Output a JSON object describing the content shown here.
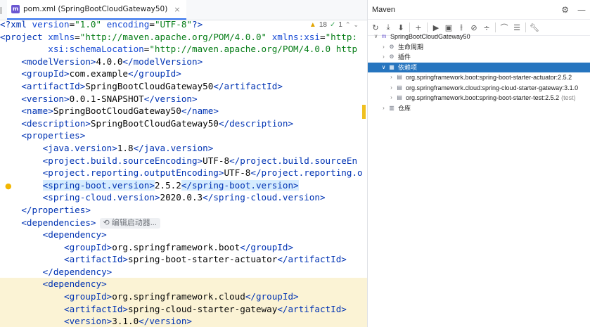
{
  "tab": {
    "label": "pom.xml (SpringBootCloudGateway50)",
    "icon": "maven-file-icon"
  },
  "status": {
    "warnings": "18",
    "checks": "1"
  },
  "code": [
    {
      "parts": [
        [
          "t",
          "<?xml "
        ],
        [
          "a",
          "version"
        ],
        [
          "",
          "="
        ],
        [
          "v",
          "\"1.0\""
        ],
        [
          "a",
          " encoding"
        ],
        [
          "",
          "="
        ],
        [
          "v",
          "\"UTF-8\""
        ],
        [
          "t",
          "?>"
        ]
      ]
    },
    {
      "parts": [
        [
          "t",
          "<project "
        ],
        [
          "a",
          "xmlns"
        ],
        [
          "",
          "="
        ],
        [
          "v",
          "\"http://maven.apache.org/POM/4.0.0\""
        ],
        [
          "a",
          " xmlns:xsi"
        ],
        [
          "",
          "="
        ],
        [
          "v",
          "\"http:"
        ]
      ]
    },
    {
      "parts": [
        [
          "",
          "         "
        ],
        [
          "a",
          "xsi:schemaLocation"
        ],
        [
          "",
          "="
        ],
        [
          "v",
          "\"http://maven.apache.org/POM/4.0.0 http"
        ]
      ]
    },
    {
      "parts": [
        [
          "",
          "    "
        ],
        [
          "t",
          "<modelVersion>"
        ],
        [
          "",
          "4.0.0"
        ],
        [
          "t",
          "</modelVersion>"
        ]
      ]
    },
    {
      "parts": [
        [
          "",
          "    "
        ],
        [
          "t",
          "<groupId>"
        ],
        [
          "",
          "com.example"
        ],
        [
          "t",
          "</groupId>"
        ]
      ]
    },
    {
      "parts": [
        [
          "",
          "    "
        ],
        [
          "t",
          "<artifactId>"
        ],
        [
          "",
          "SpringBootCloudGateway50"
        ],
        [
          "t",
          "</artifactId>"
        ]
      ]
    },
    {
      "parts": [
        [
          "",
          "    "
        ],
        [
          "t",
          "<version>"
        ],
        [
          "",
          "0.0.1-SNAPSHOT"
        ],
        [
          "t",
          "</version>"
        ]
      ]
    },
    {
      "parts": [
        [
          "",
          "    "
        ],
        [
          "t",
          "<name>"
        ],
        [
          "",
          "SpringBootCloudGateway50"
        ],
        [
          "t",
          "</name>"
        ]
      ]
    },
    {
      "parts": [
        [
          "",
          "    "
        ],
        [
          "t",
          "<description>"
        ],
        [
          "",
          "SpringBootCloudGateway50"
        ],
        [
          "t",
          "</description>"
        ]
      ]
    },
    {
      "parts": [
        [
          "",
          "    "
        ],
        [
          "t",
          "<properties>"
        ]
      ]
    },
    {
      "parts": [
        [
          "",
          "        "
        ],
        [
          "t",
          "<java.version>"
        ],
        [
          "",
          "1.8"
        ],
        [
          "t",
          "</java.version>"
        ]
      ]
    },
    {
      "parts": [
        [
          "",
          "        "
        ],
        [
          "t",
          "<project.build.sourceEncoding>"
        ],
        [
          "",
          "UTF-8"
        ],
        [
          "t",
          "</project.build.sourceEn"
        ]
      ]
    },
    {
      "parts": [
        [
          "",
          "        "
        ],
        [
          "t",
          "<project.reporting.outputEncoding>"
        ],
        [
          "",
          "UTF-8"
        ],
        [
          "t",
          "</project.reporting.o"
        ]
      ]
    },
    {
      "parts": [
        [
          "",
          "        "
        ],
        [
          "ts",
          "<spring-boot.version>"
        ],
        [
          "",
          "2.5.2"
        ],
        [
          "ts",
          "</spring-boot.version>"
        ]
      ]
    },
    {
      "parts": [
        [
          "",
          "        "
        ],
        [
          "t",
          "<spring-cloud.version>"
        ],
        [
          "",
          "2020.0.3"
        ],
        [
          "t",
          "</spring-cloud.version>"
        ]
      ]
    },
    {
      "parts": [
        [
          "",
          "    "
        ],
        [
          "t",
          "</properties>"
        ]
      ]
    },
    {
      "parts": [
        [
          "",
          "    "
        ],
        [
          "t",
          "<dependencies>"
        ]
      ],
      "hint": "编辑启动器..."
    },
    {
      "parts": [
        [
          "",
          "        "
        ],
        [
          "t",
          "<dependency>"
        ]
      ]
    },
    {
      "parts": [
        [
          "",
          "            "
        ],
        [
          "t",
          "<groupId>"
        ],
        [
          "",
          "org.springframework.boot"
        ],
        [
          "t",
          "</groupId>"
        ]
      ]
    },
    {
      "parts": [
        [
          "",
          "            "
        ],
        [
          "t",
          "<artifactId>"
        ],
        [
          "",
          "spring-boot-starter-actuator"
        ],
        [
          "t",
          "</artifactId>"
        ]
      ]
    },
    {
      "parts": [
        [
          "",
          "        "
        ],
        [
          "t",
          "</dependency>"
        ]
      ]
    },
    {
      "parts": [
        [
          "",
          "        "
        ],
        [
          "t",
          "<dependency>"
        ]
      ],
      "hl": true
    },
    {
      "parts": [
        [
          "",
          "            "
        ],
        [
          "t",
          "<groupId>"
        ],
        [
          "",
          "org.springframework.cloud"
        ],
        [
          "t",
          "</groupId>"
        ]
      ],
      "hl": true
    },
    {
      "parts": [
        [
          "",
          "            "
        ],
        [
          "t",
          "<artifactId>"
        ],
        [
          "",
          "spring-cloud-starter-gateway"
        ],
        [
          "t",
          "</artifactId>"
        ]
      ],
      "hl": true
    },
    {
      "parts": [
        [
          "",
          "            "
        ],
        [
          "t",
          "<version>"
        ],
        [
          "",
          "3.1.0"
        ],
        [
          "t",
          "</version>"
        ]
      ],
      "hl": true
    }
  ],
  "maven": {
    "title": "Maven",
    "tree": [
      {
        "label": "SpringBootCloudGateway50",
        "level": 0,
        "chev": "∨",
        "icon": "maven-project-icon"
      },
      {
        "label": "生命周期",
        "level": 1,
        "chev": "›",
        "icon": "lifecycle-folder-icon"
      },
      {
        "label": "插件",
        "level": 1,
        "chev": "›",
        "icon": "plugins-folder-icon"
      },
      {
        "label": "依赖项",
        "level": 1,
        "chev": "∨",
        "icon": "dependencies-folder-icon",
        "selected": true
      },
      {
        "label": "org.springframework.boot:spring-boot-starter-actuator:2.5.2",
        "level": 2,
        "chev": "›",
        "icon": "library-icon"
      },
      {
        "label": "org.springframework.cloud:spring-cloud-starter-gateway:3.1.0",
        "level": 2,
        "chev": "›",
        "icon": "library-icon"
      },
      {
        "label": "org.springframework.boot:spring-boot-starter-test:2.5.2",
        "level": 2,
        "chev": "›",
        "icon": "library-icon",
        "suffix": "(test)"
      },
      {
        "label": "仓库",
        "level": 1,
        "chev": "›",
        "icon": "repositories-folder-icon"
      }
    ]
  }
}
